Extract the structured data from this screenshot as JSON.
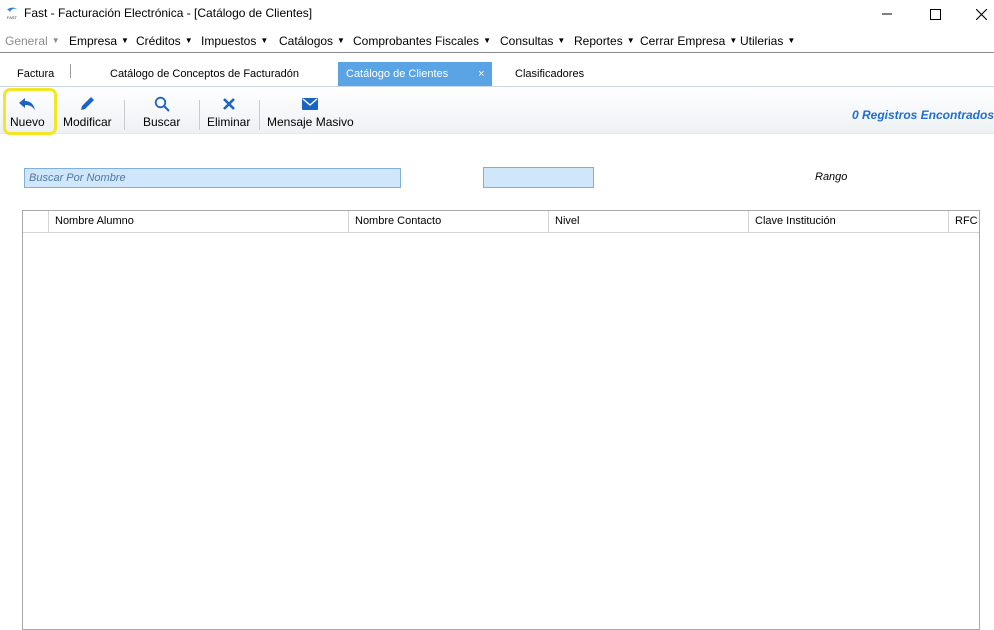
{
  "window": {
    "title": "Fast - Facturación Electrónica - [Catálogo de Clientes]",
    "logo_text": "FAST"
  },
  "menu": [
    {
      "label": "General",
      "disabled": true
    },
    {
      "label": "Empresa"
    },
    {
      "label": "Créditos"
    },
    {
      "label": "Impuestos"
    },
    {
      "label": "Catálogos"
    },
    {
      "label": "Comprobantes Fiscales"
    },
    {
      "label": "Consultas"
    },
    {
      "label": "Reportes"
    },
    {
      "label": "Cerrar Empresa"
    },
    {
      "label": "Utilerias"
    }
  ],
  "tabs": [
    {
      "label": "Factura"
    },
    {
      "label": "Catálogo de Conceptos de Facturadón"
    },
    {
      "label": "Catálogo de Clientes",
      "active": true,
      "close": "×"
    },
    {
      "label": "Clasificadores"
    }
  ],
  "toolbar": {
    "nuevo": "Nuevo",
    "modificar": "Modificar",
    "buscar": "Buscar",
    "eliminar": "Eliminar",
    "mensaje": "Mensaje Masivo",
    "records": "0 Registros Encontrados"
  },
  "filters": {
    "search_placeholder": "Buscar Por Nombre",
    "search_value": "",
    "range_label": "Rango"
  },
  "grid": {
    "columns": [
      "",
      "Nombre Alumno",
      "Nombre Contacto",
      "Nivel",
      "Clave Institución",
      "RFC Escuela"
    ],
    "rows": []
  },
  "colors": {
    "accent": "#5aa4e6",
    "records_text": "#1e6fd0",
    "input_bg": "#cfe6fb",
    "highlight": "#f2e626"
  }
}
